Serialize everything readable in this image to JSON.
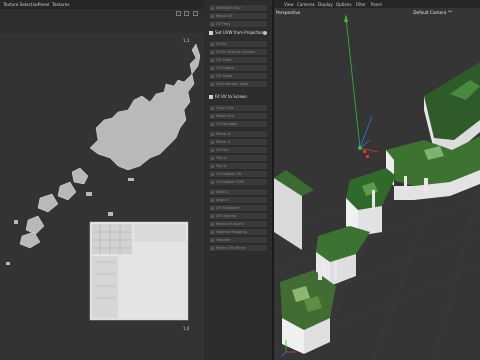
{
  "uv_editor": {
    "menu": [
      "Texture Selection",
      "Panel",
      "Textures"
    ],
    "corner_top_right": "1,1",
    "corner_bottom_right": "1,0"
  },
  "commands": {
    "header_project": "Set UVW from Projection",
    "header_uv_to_screen": "Fit UV to Screen",
    "items_top": [
      "Selection Tool",
      "Relax UV",
      "UV Peel",
      "Fit UV"
    ],
    "items_mid": [
      "Fit UV Area to Canvas",
      "UV Shelf",
      "UV Rotate",
      "UV Scale",
      "Grid Sample Tools",
      "Copy UVs",
      "Paste UVs",
      "UV Manager"
    ],
    "items_bottom": [
      "Mirror U",
      "Mirror V",
      "UV Flip",
      "Flip U",
      "Flip V",
      "UV Rotate CW",
      "UV Rotate CCW",
      "Align U",
      "Align V",
      "UV Straighten",
      "UV Unwrap",
      "Relax UV Island",
      "Optimal Mapping",
      "Transfer",
      "Paste UVs Mirror"
    ]
  },
  "viewport": {
    "menu": [
      "View",
      "Cameras",
      "Display",
      "Options",
      "Filter",
      "Panel"
    ],
    "title": "Perspective",
    "camera": "Default Camera °*"
  },
  "colors": {
    "uv_island": "#b9b9b9",
    "terrain_green": "#3f7a34",
    "cliff_white": "#e8e8e8",
    "axis_green": "#2fbf3a",
    "axis_blue": "#3a6ff0",
    "axis_red": "#d63a3a"
  }
}
